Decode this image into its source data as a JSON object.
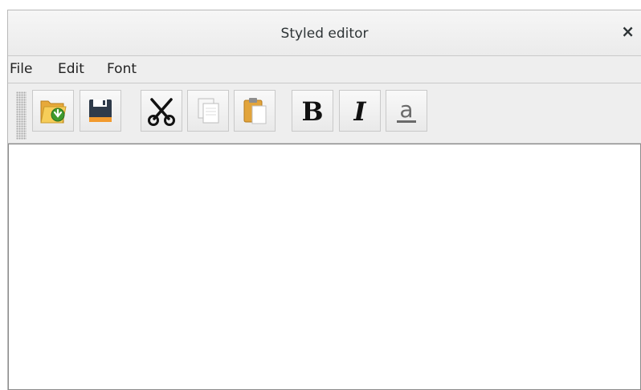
{
  "window": {
    "title": "Styled editor",
    "close_symbol": "×"
  },
  "menu": {
    "items": [
      "File",
      "Edit",
      "Font"
    ]
  },
  "toolbar": {
    "buttons": [
      {
        "name": "open",
        "icon": "open-folder-icon"
      },
      {
        "name": "save",
        "icon": "floppy-disk-icon"
      },
      {
        "name": "cut",
        "icon": "scissors-icon"
      },
      {
        "name": "copy",
        "icon": "copy-icon"
      },
      {
        "name": "paste",
        "icon": "paste-icon"
      },
      {
        "name": "bold",
        "icon": "bold-icon",
        "label": "B"
      },
      {
        "name": "italic",
        "icon": "italic-icon",
        "label": "I"
      },
      {
        "name": "underline",
        "icon": "underline-icon",
        "label": "a"
      }
    ]
  },
  "editor": {
    "text": ""
  },
  "colors": {
    "titlebar": "#ececec",
    "menubar": "#eeeeee",
    "editor_bg": "#ffffff"
  }
}
